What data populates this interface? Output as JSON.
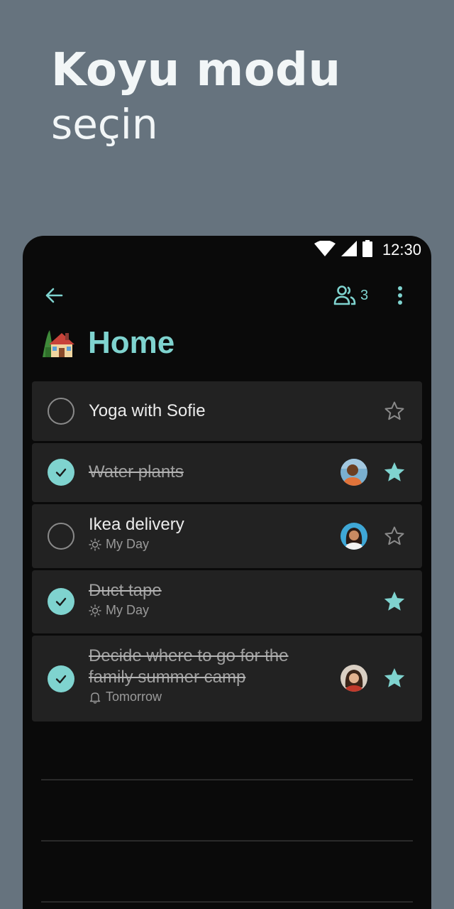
{
  "promo": {
    "line1": "Koyu modu",
    "line2": "seçin"
  },
  "status_bar": {
    "time": "12:30",
    "icons": [
      "wifi-icon",
      "signal-icon",
      "battery-icon"
    ]
  },
  "toolbar": {
    "back_icon": "arrow-left-icon",
    "members_icon": "people-icon",
    "members_count": "3",
    "more_icon": "more-vertical-icon"
  },
  "list": {
    "emoji": "house-with-garden",
    "title": "Home"
  },
  "colors": {
    "accent": "#7fd3cf",
    "background": "#0a0a0a",
    "card": "#222222",
    "page_bg": "#66737e"
  },
  "tasks": [
    {
      "title": "Yoga with Sofie",
      "completed": false,
      "meta": "",
      "meta_icon": "",
      "avatar": false,
      "starred": false
    },
    {
      "title": "Water plants",
      "completed": true,
      "meta": "",
      "meta_icon": "",
      "avatar": true,
      "starred": true
    },
    {
      "title": "Ikea delivery",
      "completed": false,
      "meta": "My Day",
      "meta_icon": "sun-icon",
      "avatar": true,
      "starred": false
    },
    {
      "title": "Duct tape",
      "completed": true,
      "meta": "My Day",
      "meta_icon": "sun-icon",
      "avatar": false,
      "starred": true
    },
    {
      "title_line1": "Decide where to go for the",
      "title_line2": "family summer camp",
      "completed": true,
      "meta": "Tomorrow",
      "meta_icon": "bell-icon",
      "avatar": true,
      "starred": true
    }
  ]
}
